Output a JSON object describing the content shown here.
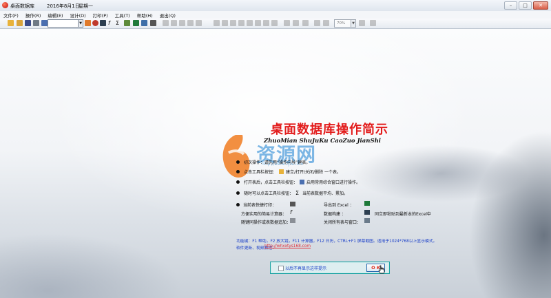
{
  "titlebar": {
    "title": "桌面数据库",
    "date": "2016年8月1日",
    "weekday": "星期一",
    "buttons": [
      "–",
      "□",
      "✕"
    ]
  },
  "menu": [
    "文件(F)",
    "操作(R)",
    "编辑(E)",
    "设计(D)",
    "打印(P)",
    "工具(T)",
    "帮助(H)",
    "退出(Q)"
  ],
  "toolbar": {
    "zoom": "70%"
  },
  "watermark": {
    "text": "资源网",
    "url": "http://www.zyw.com"
  },
  "content": {
    "title": "桌面数据库操作简示",
    "pinyin": "ZhuoMian ShuJuKu CaoZuo JianShi",
    "tips": [
      "初次操作：请先用“操作向导”建表。",
      "点击工具栏按钮：",
      "建立/打开/关闭/删除 一个表。",
      "打开表后，点击工具栏按钮：",
      "启用常用综合窗口进行操作。",
      "随时可以点击工具栏按钮：",
      "当前表数据平均、累加。"
    ],
    "grid": [
      "当前表快捷打印：",
      "导出到 Excel ：",
      "方便实用的简易计算器：",
      "数据构建 ：",
      "同立即粘贴到最新本的Excel中",
      "随键同操作或表数据追加：",
      "关闭所有表与窗口："
    ],
    "hotkeys": "功能键：F1 帮助，F2 放大镜，F11 计算器，F12 日历，CTRL+F1 屏幕截图。适用于1024*768以上显示模式。",
    "update_label": "软件更新、视频教程：",
    "update_link": "http://whxxtys168.com"
  },
  "footer": {
    "checkbox_label": "以后不再显示这样提示",
    "ok_label": "O K"
  },
  "colors": {
    "title_red": "#e21c1c",
    "link_blue": "#1a3fc8",
    "frame_teal": "#1ca3a3"
  }
}
